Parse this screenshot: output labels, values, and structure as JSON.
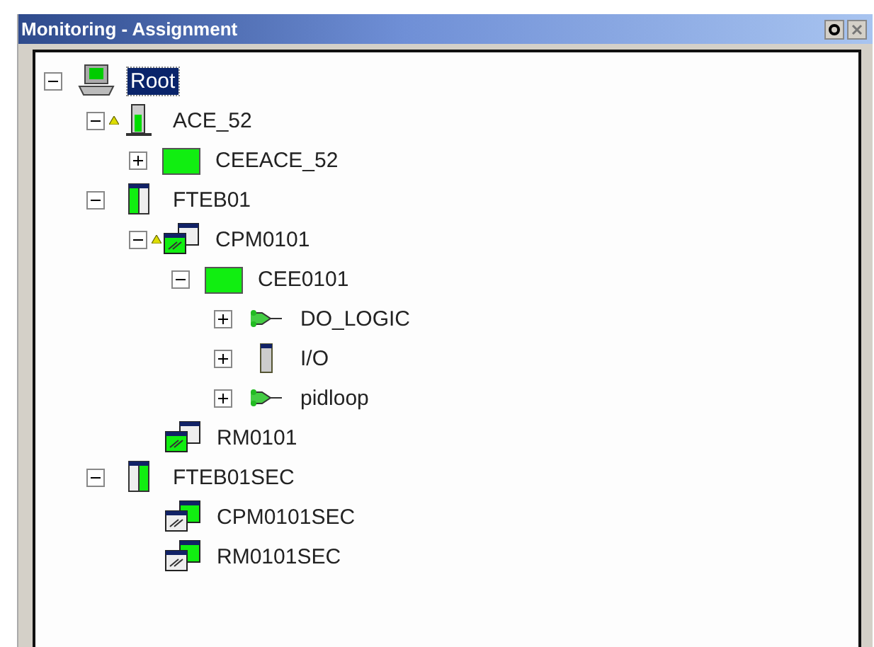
{
  "window": {
    "title": "Monitoring - Assignment"
  },
  "tree": [
    {
      "label": "Root",
      "kind": "computer",
      "selected": true,
      "warning": false,
      "expanded": true,
      "children": [
        {
          "label": "ACE_52",
          "kind": "controller",
          "selected": false,
          "warning": true,
          "expanded": true,
          "children": [
            {
              "label": "CEEACE_52",
              "kind": "cee",
              "selected": false,
              "warning": false,
              "expanded": false
            }
          ]
        },
        {
          "label": "FTEB01",
          "kind": "fte",
          "selected": false,
          "warning": false,
          "expanded": true,
          "children": [
            {
              "label": "CPM0101",
              "kind": "cpm",
              "selected": false,
              "warning": true,
              "expanded": true,
              "children": [
                {
                  "label": "CEE0101",
                  "kind": "cee",
                  "selected": false,
                  "warning": false,
                  "expanded": true,
                  "children": [
                    {
                      "label": "DO_LOGIC",
                      "kind": "logic",
                      "selected": false,
                      "warning": false,
                      "expanded": false
                    },
                    {
                      "label": "I/O",
                      "kind": "io",
                      "selected": false,
                      "warning": false,
                      "expanded": false
                    },
                    {
                      "label": "pidloop",
                      "kind": "logic",
                      "selected": false,
                      "warning": false,
                      "expanded": false
                    }
                  ]
                }
              ]
            },
            {
              "label": "RM0101",
              "kind": "cpm",
              "selected": false,
              "warning": false
            }
          ]
        },
        {
          "label": "FTEB01SEC",
          "kind": "fte_sec",
          "selected": false,
          "warning": false,
          "expanded": true,
          "children": [
            {
              "label": "CPM0101SEC",
              "kind": "cpm_sec",
              "selected": false,
              "warning": false
            },
            {
              "label": "RM0101SEC",
              "kind": "cpm_sec",
              "selected": false,
              "warning": false
            }
          ]
        }
      ]
    }
  ]
}
